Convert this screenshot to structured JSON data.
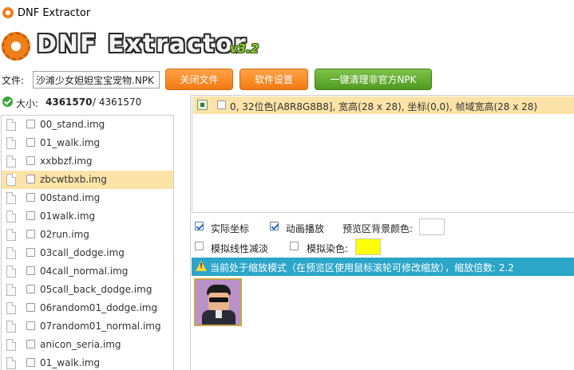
{
  "window": {
    "title": "DNF Extractor"
  },
  "banner": {
    "logo_text": "DNF Extractor",
    "version": "v3.2"
  },
  "toolbar": {
    "file_label": "文件:",
    "file_value": "沙滩少女妲妲宝宝宠物.NPK",
    "close_file": "关闭文件",
    "settings": "软件设置",
    "clean_npk": "一键清理非官方NPK"
  },
  "size": {
    "label": "大小:",
    "current": "4361570",
    "total": "/ 4361570"
  },
  "file_list": [
    {
      "name": "00_stand.img",
      "selected": false
    },
    {
      "name": "01_walk.img",
      "selected": false
    },
    {
      "name": "xxbbzf.img",
      "selected": false
    },
    {
      "name": "zbcwtbxb.img",
      "selected": true
    },
    {
      "name": "00stand.img",
      "selected": false
    },
    {
      "name": "01walk.img",
      "selected": false
    },
    {
      "name": "02run.img",
      "selected": false
    },
    {
      "name": "03call_dodge.img",
      "selected": false
    },
    {
      "name": "04call_normal.img",
      "selected": false
    },
    {
      "name": "05call_back_dodge.img",
      "selected": false
    },
    {
      "name": "06random01_dodge.img",
      "selected": false
    },
    {
      "name": "07random01_normal.img",
      "selected": false
    },
    {
      "name": "anicon_seria.img",
      "selected": false
    },
    {
      "name": "01_walk.img",
      "selected": false
    }
  ],
  "frames": [
    {
      "text": "0, 32位色[A8R8G8B8], 宽高(28 x 28), 坐标(0,0), 帧域宽高(28 x 28)"
    }
  ],
  "options": {
    "actual_coords": "实际坐标",
    "animation": "动画播放",
    "preview_bg": "预览区背景颜色:",
    "linear_dodge": "模拟线性减淡",
    "dye": "模拟染色:",
    "preview_bg_color": "#ffffff",
    "dye_color": "#ffff00"
  },
  "info": {
    "text": "当前处于缩放模式（在预览区使用鼠标滚轮可修改缩放），缩放倍数: 2.2"
  },
  "colors": {
    "orange_button": "#f27a12",
    "green_button": "#4f9a1f",
    "info_bar": "#2ba6c9",
    "selection": "#fce3a8"
  }
}
